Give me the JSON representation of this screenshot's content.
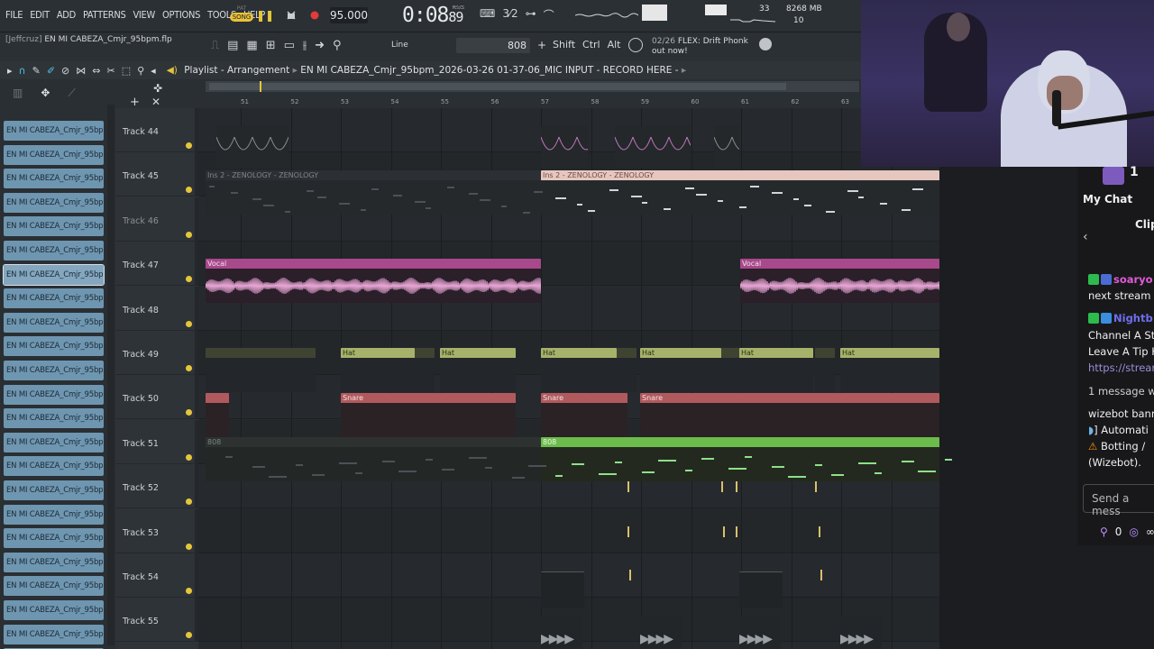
{
  "menu": [
    "FILE",
    "EDIT",
    "ADD",
    "PATTERNS",
    "VIEW",
    "OPTIONS",
    "TOOLS",
    "HELP"
  ],
  "transport": {
    "pat_label": "PAT",
    "song_label": "SONG",
    "tempo": "95.000",
    "time_main": "0:08",
    "time_sub": "89",
    "time_unit": "M:S:CS",
    "snap_label": "3⁄2"
  },
  "status": {
    "cpu_value": "33",
    "memory": "8268 MB",
    "polyphony": "10"
  },
  "project": {
    "user": "[Jeffcruz]",
    "file": "EN MI CABEZA_Cmjr_95bpm.flp"
  },
  "toolbar2": {
    "line_label": "Line",
    "counter": "808",
    "plus": "+",
    "keys": [
      "Shift",
      "Ctrl",
      "Alt"
    ],
    "news_date": "02/26",
    "news_title": "FLEX: Drift Phonk",
    "news_sub": "out now!"
  },
  "playlist": {
    "title_prefix": "Playlist - Arrangement",
    "title_file": "EN MI CABEZA_Cmjr_95bpm_2026-03-26 01-37-06_MIC INPUT - RECORD HERE -"
  },
  "picker": {
    "clip_label": "EN MI CABEZA_Cmjr_95bp...",
    "count": 23,
    "selected_index": 6
  },
  "ruler": [
    "51",
    "52",
    "53",
    "54",
    "55",
    "56",
    "57",
    "58",
    "59",
    "60",
    "61",
    "62",
    "63"
  ],
  "tracks": [
    {
      "name": "Track 44",
      "dim": false
    },
    {
      "name": "Track 45",
      "dim": false
    },
    {
      "name": "Track 46",
      "dim": true
    },
    {
      "name": "Track 47",
      "dim": false
    },
    {
      "name": "Track 48",
      "dim": false
    },
    {
      "name": "Track 49",
      "dim": false
    },
    {
      "name": "Track 50",
      "dim": false
    },
    {
      "name": "Track 51",
      "dim": false
    },
    {
      "name": "Track 52",
      "dim": false
    },
    {
      "name": "Track 53",
      "dim": false
    },
    {
      "name": "Track 54",
      "dim": false
    },
    {
      "name": "Track 55",
      "dim": false
    }
  ],
  "clips": {
    "zen_dim": "Ins 2 - ZENOLOGY - ZENOLOGY",
    "zen": "Ins 2 - ZENOLOGY - ZENOLOGY",
    "vocal_a": "Vocal",
    "vocal_b": "Vocal",
    "hat": "Hat",
    "snare": "Snare",
    "b808_dim": "808",
    "b808": "808"
  },
  "chat": {
    "badge": "1",
    "title": "My Chat",
    "clip_label": "Clip",
    "user1": "soaryo",
    "msg1": "next stream",
    "user2": "Nightb",
    "msg2a": "Channel A St",
    "msg2b": "Leave A Tip H",
    "link": "https://stream",
    "sys1": "1 message wa",
    "sys2": "wizebot bann",
    "sys3": "] Automati",
    "sys4": "Botting /",
    "sys5": "(Wizebot).",
    "input_placeholder": "Send a mess",
    "points": "0",
    "infinity": "∞"
  },
  "colors": {
    "accent_yellow": "#e5c63a",
    "vocal": "#a8498b",
    "hat": "#a6b26a",
    "snare": "#b05a5e",
    "bass808": "#6cbc4c",
    "zenology": "#e6c7bf",
    "picker_clip": "#6f96b0"
  }
}
